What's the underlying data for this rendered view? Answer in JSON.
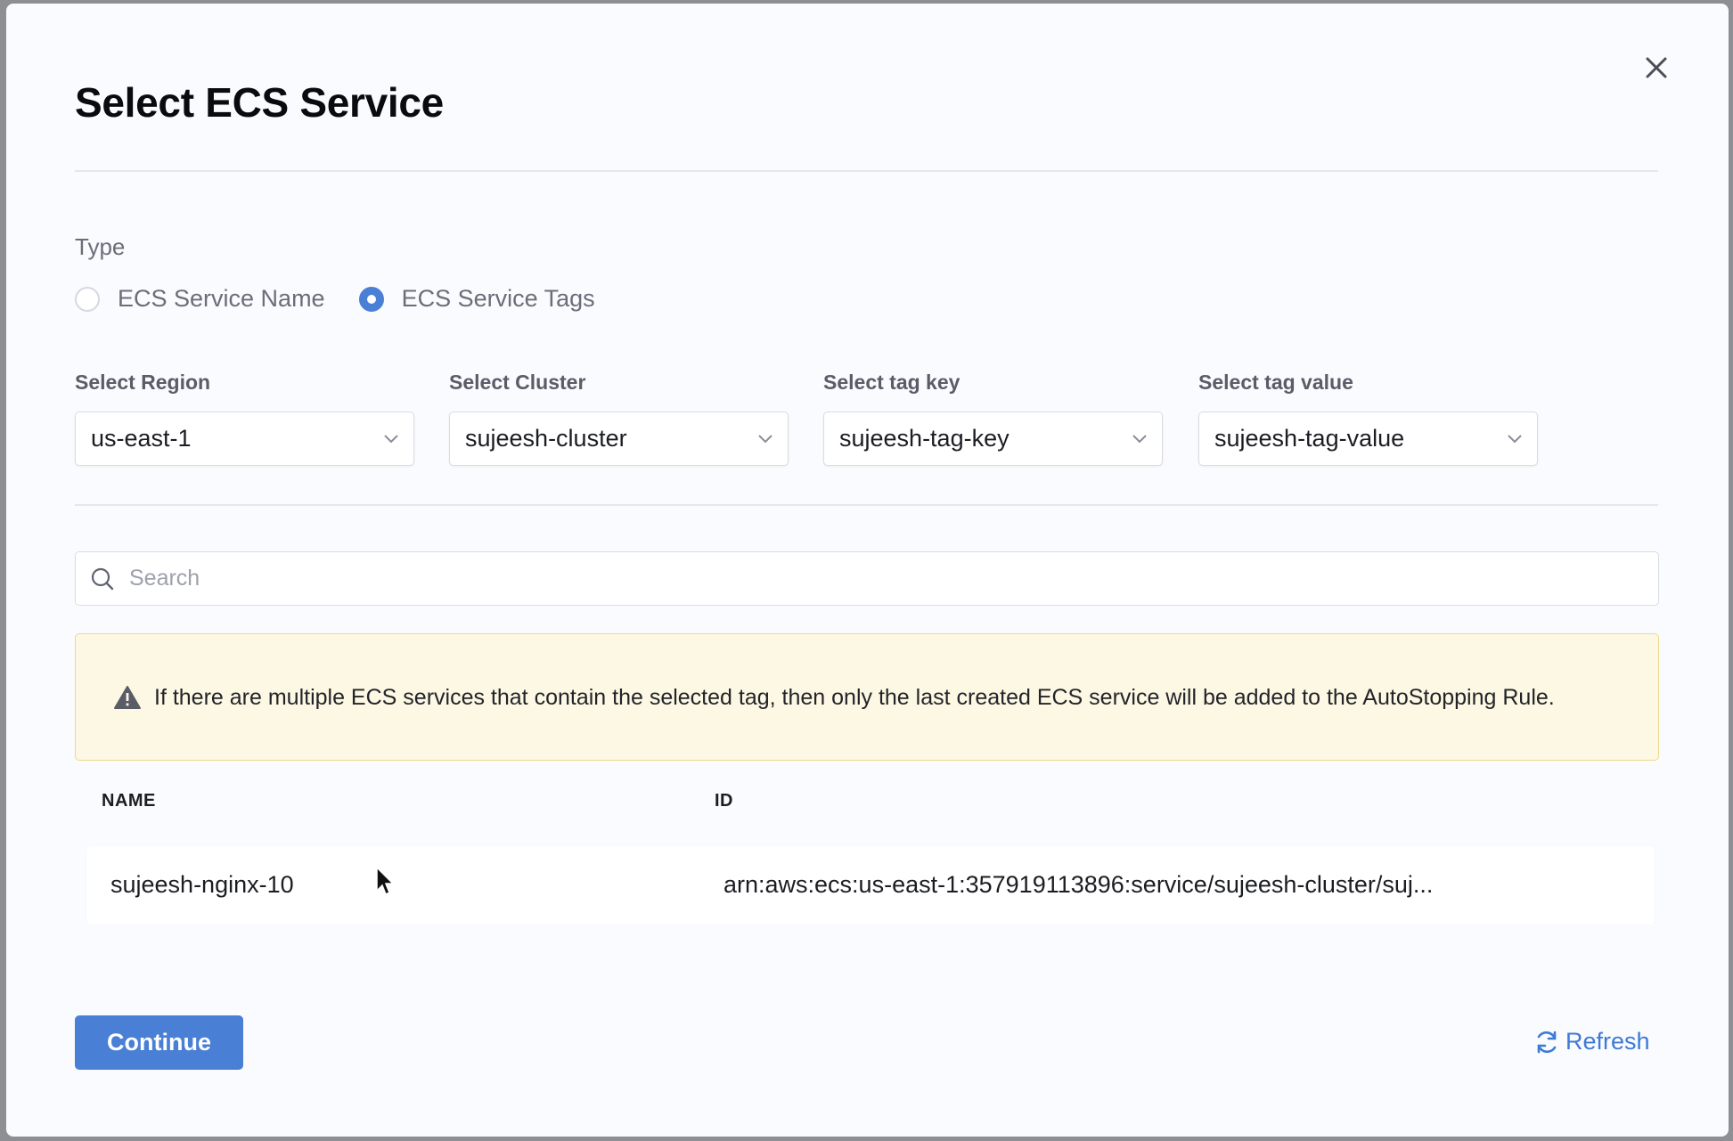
{
  "modal": {
    "title": "Select ECS Service"
  },
  "type": {
    "label": "Type",
    "options": [
      {
        "label": "ECS Service Name",
        "selected": false
      },
      {
        "label": "ECS Service Tags",
        "selected": true
      }
    ]
  },
  "filters": [
    {
      "label": "Select Region",
      "value": "us-east-1"
    },
    {
      "label": "Select Cluster",
      "value": "sujeesh-cluster"
    },
    {
      "label": "Select tag key",
      "value": "sujeesh-tag-key"
    },
    {
      "label": "Select tag value",
      "value": "sujeesh-tag-value"
    }
  ],
  "search": {
    "placeholder": "Search"
  },
  "warning": {
    "text": "If there are multiple ECS services that contain the selected tag, then only the last created ECS service will be added to the AutoStopping Rule."
  },
  "table": {
    "columns": [
      "NAME",
      "ID"
    ],
    "rows": [
      {
        "name": "sujeesh-nginx-10",
        "id": "arn:aws:ecs:us-east-1:357919113896:service/sujeesh-cluster/suj..."
      }
    ]
  },
  "footer": {
    "continue_label": "Continue",
    "refresh_label": "Refresh"
  },
  "colors": {
    "accent": "#4a7fd6",
    "warning_bg": "#fdf8e3",
    "warning_border": "#f0d98a"
  },
  "icons": {
    "close": "close-icon",
    "search": "search-icon",
    "warning": "warning-icon",
    "refresh": "refresh-icon",
    "chevron": "chevron-down-icon"
  }
}
